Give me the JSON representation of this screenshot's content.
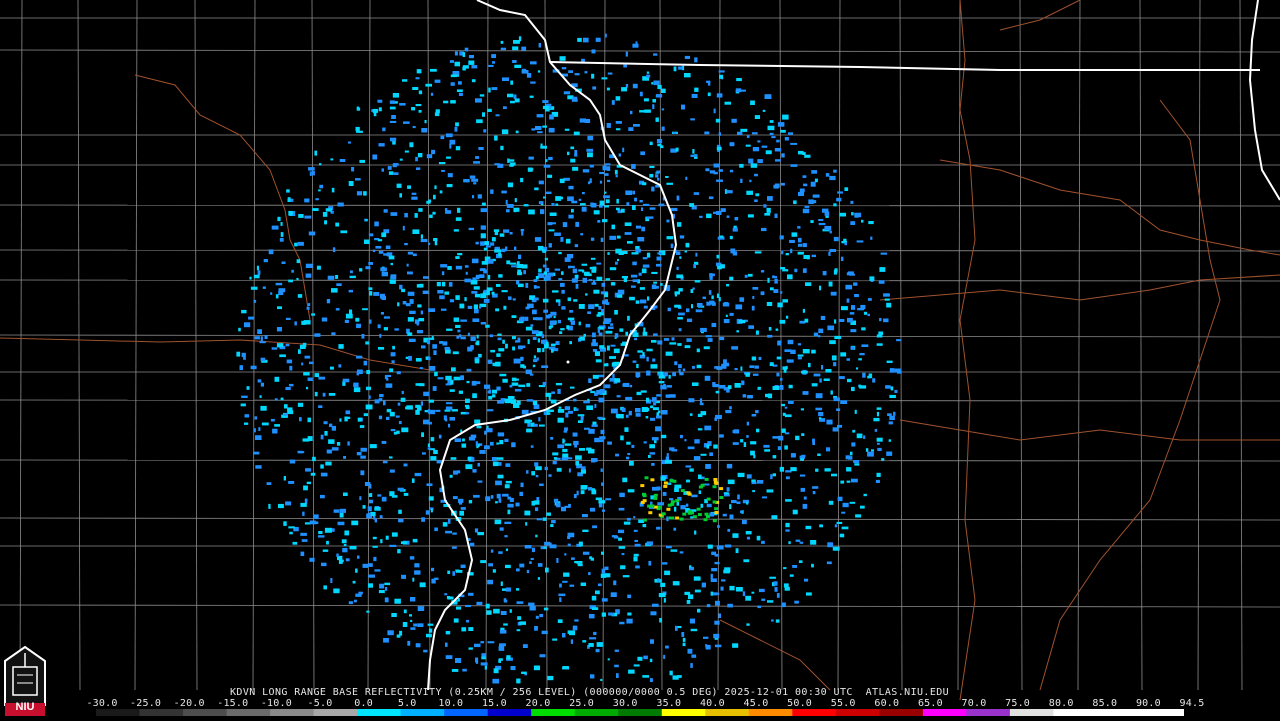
{
  "product": {
    "station": "KDVN",
    "header": "KDVN LONG RANGE BASE REFLECTIVITY (0.25KM / 256 LEVEL) (000000/0000 0.5 DEG) 2025-12-01 00:30 UTC  ATLAS.NIU.EDU"
  },
  "legend": {
    "labels": [
      "-30.0",
      "-25.0",
      "-20.0",
      "-15.0",
      "-10.0",
      "-5.0",
      "0.0",
      "5.0",
      "10.0",
      "15.0",
      "20.0",
      "25.0",
      "30.0",
      "35.0",
      "40.0",
      "45.0",
      "50.0",
      "55.0",
      "60.0",
      "65.0",
      "70.0",
      "75.0",
      "80.0",
      "85.0",
      "90.0",
      "94.5"
    ],
    "colors": [
      "#1a1a1a",
      "#333333",
      "#4d4d4d",
      "#6a6a6a",
      "#8a8a8a",
      "#a8a8a8",
      "#00e5ff",
      "#00b0ff",
      "#0066ff",
      "#0000cc",
      "#00dd00",
      "#00aa00",
      "#007a00",
      "#ffff00",
      "#e6c000",
      "#ff8c00",
      "#ff0000",
      "#cc0000",
      "#990000",
      "#ff00ff",
      "#9933cc",
      "#e0e0e0",
      "#ffffff",
      "#ffffff",
      "#ffffff"
    ]
  },
  "map_colors": {
    "state_border": "#ffffff",
    "county_line": "#8c8c8c",
    "highway": "#a0522d",
    "echo_light": "#00d8ff",
    "echo_mid": "#1e90ff",
    "echo_heavy": "#00cc33"
  },
  "logo": {
    "text": "NIU",
    "icon": "university-tower-logo-icon"
  }
}
